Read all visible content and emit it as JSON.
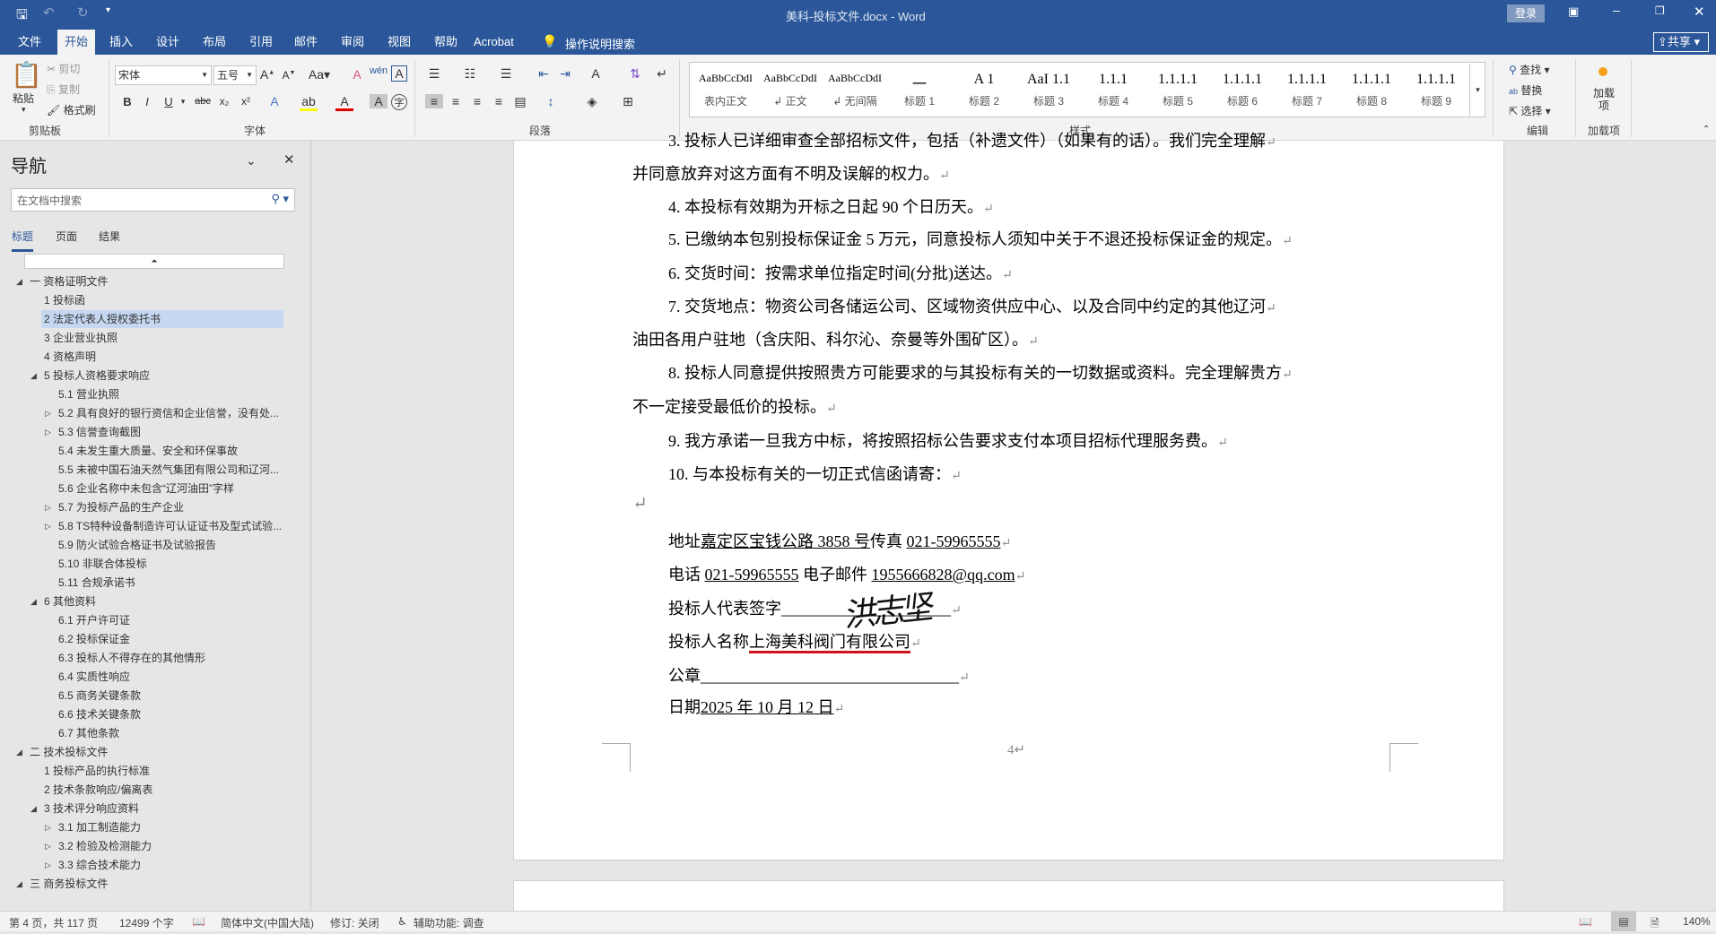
{
  "titlebar": {
    "title": "美科-投标文件.docx - Word",
    "login": "登录",
    "share": "共享"
  },
  "tabs": [
    "文件",
    "开始",
    "插入",
    "设计",
    "布局",
    "引用",
    "邮件",
    "审阅",
    "视图",
    "帮助",
    "Acrobat"
  ],
  "tell_me": "操作说明搜索",
  "ribbon": {
    "clipboard": {
      "paste": "粘贴",
      "cut": "剪切",
      "copy": "复制",
      "format_painter": "格式刷",
      "label": "剪贴板"
    },
    "font": {
      "name": "宋体",
      "size": "五号",
      "label": "字体"
    },
    "paragraph": {
      "label": "段落"
    },
    "styles": {
      "label": "样式",
      "items": [
        {
          "preview": "AaBbCcDdI",
          "name": "表内正文"
        },
        {
          "preview": "AaBbCcDdI",
          "name": "↲ 正文"
        },
        {
          "preview": "AaBbCcDdI",
          "name": "↲ 无间隔"
        },
        {
          "preview": "一",
          "name": "标题 1"
        },
        {
          "preview": "A 1",
          "name": "标题 2"
        },
        {
          "preview": "AaI 1.1",
          "name": "标题 3"
        },
        {
          "preview": "1.1.1",
          "name": "标题 4"
        },
        {
          "preview": "1.1.1.1",
          "name": "标题 5"
        },
        {
          "preview": "1.1.1.1",
          "name": "标题 6"
        },
        {
          "preview": "1.1.1.1",
          "name": "标题 7"
        },
        {
          "preview": "1.1.1.1",
          "name": "标题 8"
        },
        {
          "preview": "1.1.1.1",
          "name": "标题 9"
        }
      ]
    },
    "editing": {
      "find": "查找",
      "replace": "替换",
      "select": "选择",
      "label": "编辑"
    },
    "addins": {
      "button": "加载项",
      "label": "加载项"
    }
  },
  "nav": {
    "title": "导航",
    "search_placeholder": "在文档中搜索",
    "tabs": [
      "标题",
      "页面",
      "结果"
    ],
    "items": [
      {
        "level": 0,
        "toggle": "open",
        "text": "一 资格证明文件"
      },
      {
        "level": 1,
        "toggle": "",
        "text": "1 投标函"
      },
      {
        "level": 1,
        "toggle": "",
        "text": "2 法定代表人授权委托书",
        "selected": true
      },
      {
        "level": 1,
        "toggle": "",
        "text": "3 企业营业执照"
      },
      {
        "level": 1,
        "toggle": "",
        "text": "4 资格声明"
      },
      {
        "level": 1,
        "toggle": "open",
        "text": "5 投标人资格要求响应"
      },
      {
        "level": 2,
        "toggle": "",
        "text": "5.1 营业执照"
      },
      {
        "level": 2,
        "toggle": "closed",
        "text": "5.2 具有良好的银行资信和企业信誉，没有处..."
      },
      {
        "level": 2,
        "toggle": "closed",
        "text": "5.3 信誉查询截图"
      },
      {
        "level": 2,
        "toggle": "",
        "text": "5.4 未发生重大质量、安全和环保事故"
      },
      {
        "level": 2,
        "toggle": "",
        "text": "5.5 未被中国石油天然气集团有限公司和辽河..."
      },
      {
        "level": 2,
        "toggle": "",
        "text": "5.6 企业名称中未包含“辽河油田”字样"
      },
      {
        "level": 2,
        "toggle": "closed",
        "text": "5.7 为投标产品的生产企业"
      },
      {
        "level": 2,
        "toggle": "closed",
        "text": "5.8 TS特种设备制造许可认证证书及型式试验..."
      },
      {
        "level": 2,
        "toggle": "",
        "text": "5.9 防火试验合格证书及试验报告"
      },
      {
        "level": 2,
        "toggle": "",
        "text": "5.10 非联合体投标"
      },
      {
        "level": 2,
        "toggle": "",
        "text": "5.11 合规承诺书"
      },
      {
        "level": 1,
        "toggle": "open",
        "text": "6 其他资料"
      },
      {
        "level": 2,
        "toggle": "",
        "text": "6.1 开户许可证"
      },
      {
        "level": 2,
        "toggle": "",
        "text": "6.2 投标保证金"
      },
      {
        "level": 2,
        "toggle": "",
        "text": "6.3 投标人不得存在的其他情形"
      },
      {
        "level": 2,
        "toggle": "",
        "text": "6.4 实质性响应"
      },
      {
        "level": 2,
        "toggle": "",
        "text": "6.5 商务关键条款"
      },
      {
        "level": 2,
        "toggle": "",
        "text": "6.6 技术关键条款"
      },
      {
        "level": 2,
        "toggle": "",
        "text": "6.7 其他条款"
      },
      {
        "level": 0,
        "toggle": "open",
        "text": "二 技术投标文件"
      },
      {
        "level": 1,
        "toggle": "",
        "text": "1 投标产品的执行标准"
      },
      {
        "level": 1,
        "toggle": "",
        "text": "2 技术条款响应/偏离表"
      },
      {
        "level": 1,
        "toggle": "open",
        "text": "3 技术评分响应资料"
      },
      {
        "level": 2,
        "toggle": "closed",
        "text": "3.1 加工制造能力"
      },
      {
        "level": 2,
        "toggle": "closed",
        "text": "3.2 检验及检测能力"
      },
      {
        "level": 2,
        "toggle": "closed",
        "text": "3.3 综合技术能力"
      },
      {
        "level": 0,
        "toggle": "open",
        "text": "三 商务投标文件"
      }
    ]
  },
  "document": {
    "lines": [
      {
        "indent": 1,
        "text": "3.  投标人已详细审查全部招标文件，包括（补遗文件）（如果有的话）。我们完全理解"
      },
      {
        "indent": 0,
        "text": "并同意放弃对这方面有不明及误解的权力。"
      },
      {
        "indent": 1,
        "text": "4.   本投标有效期为开标之日起 90 个日历天。"
      },
      {
        "indent": 1,
        "text": "5.   已缴纳本包别投标保证金 5 万元，同意投标人须知中关于不退还投标保证金的规定。"
      },
      {
        "indent": 1,
        "text": "6.   交货时间：按需求单位指定时间(分批)送达。"
      },
      {
        "indent": 1,
        "text": "7.    交货地点：物资公司各储运公司、区域物资供应中心、以及合同中约定的其他辽河"
      },
      {
        "indent": 0,
        "text": "油田各用户驻地（含庆阳、科尔沁、奈曼等外围矿区）。"
      },
      {
        "indent": 1,
        "text": "8.   投标人同意提供按照贵方可能要求的与其投标有关的一切数据或资料。完全理解贵方"
      },
      {
        "indent": 0,
        "text": "不一定接受最低价的投标。"
      },
      {
        "indent": 1,
        "text": "9.   我方承诺一旦我方中标，将按照招标公告要求支付本项目招标代理服务费。"
      },
      {
        "indent": 1,
        "text": "10. 与本投标有关的一切正式信函请寄："
      },
      {
        "indent": 0,
        "text": ""
      }
    ],
    "contact": {
      "address_label": "地址",
      "address": "嘉定区宝钱公路 3858 号",
      "fax_label": "传真 ",
      "fax": "021-59965555",
      "phone_label": "电话 ",
      "phone": "021-59965555",
      "email_label": " 电子邮件 ",
      "email": "1955666828@qq.com",
      "signer_label": "投标人代表签字",
      "signature": "洪志坚",
      "company_label": "投标人名称",
      "company": "上海美科阀门有限公司",
      "seal_label": "公章",
      "date_label": "日期",
      "date": "2025 年 10 月 12 日"
    },
    "page_number": "4"
  },
  "status": {
    "page": "第 4 页，共 117 页",
    "words": "12499 个字",
    "language": "简体中文(中国大陆)",
    "track": "修订: 关闭",
    "accessibility": "辅助功能: 调查",
    "zoom": "140%"
  }
}
